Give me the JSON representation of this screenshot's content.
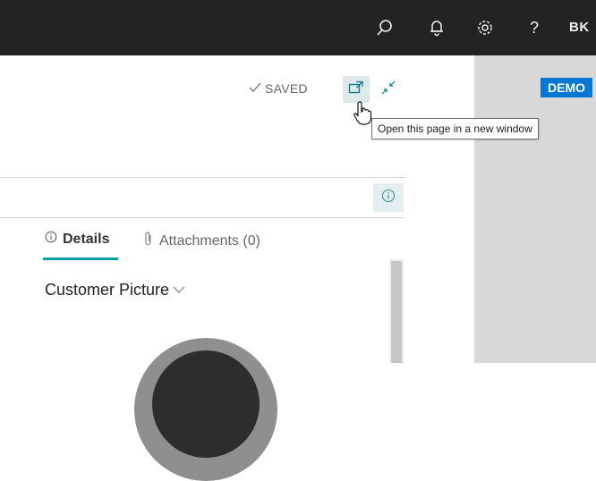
{
  "topbar": {
    "icons": [
      "search-icon",
      "bell-icon",
      "gear-icon",
      "help-icon"
    ],
    "help_glyph": "?",
    "avatar_initials": "BK"
  },
  "badge": {
    "label": "DEMO",
    "color": "#0078d4"
  },
  "header": {
    "saved_label": "SAVED",
    "open_new_window_icon": "open-in-new-window-icon",
    "collapse_icon": "collapse-icon"
  },
  "tooltip": {
    "text": "Open this page in a new window"
  },
  "factbox": {
    "tabs": [
      {
        "label": "Details",
        "icon": "info-icon",
        "active": true
      },
      {
        "label": "Attachments (0)",
        "icon": "paperclip-icon",
        "active": false
      }
    ],
    "section_title": "Customer Picture",
    "accent_color": "#00a3a3"
  }
}
